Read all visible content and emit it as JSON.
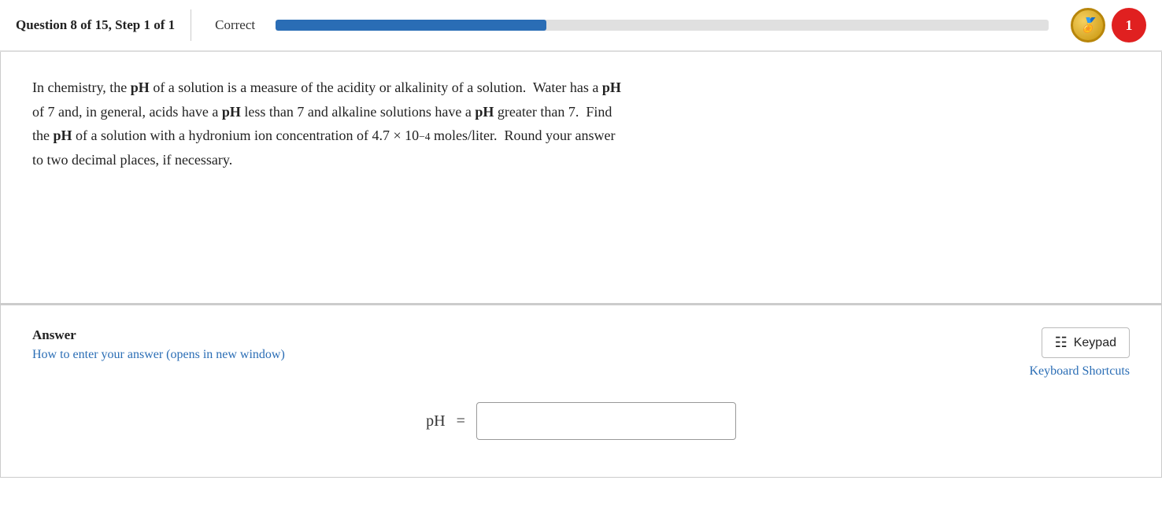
{
  "header": {
    "question_label": "Question 8 of 15, Step 1 of 1",
    "correct_label": "Correct",
    "progress_percent": 35,
    "coin_symbol": "✦",
    "heart_count": "1"
  },
  "question": {
    "paragraph1_before_ph1": "In chemistry, the ",
    "ph_bold_1": "pH",
    "paragraph1_after_ph1": " of a solution is a measure of the acidity or alkalinity of a solution.  Water has a ",
    "ph_bold_2": "pH",
    "paragraph2_before_ph2": " of 7 and, in general, acids have a ",
    "ph_bold_3": "pH",
    "paragraph2_after_ph2": " less than 7 and alkaline solutions have a ",
    "ph_bold_4": "pH",
    "paragraph2_end": " greater than 7.  Find",
    "paragraph3_before_ph3": "the ",
    "ph_bold_5": "pH",
    "paragraph3_middle": " of a solution with a hydronium ion concentration of ",
    "math_coefficient": "4.7",
    "math_times": "×",
    "math_base": "10",
    "math_exponent": "−4",
    "paragraph3_end": " moles/liter.  Round your answer",
    "paragraph4": "to two decimal places, if necessary."
  },
  "answer": {
    "title": "Answer",
    "how_to_link": "How to enter your answer (opens in new window)",
    "keypad_label": "Keypad",
    "keyboard_shortcuts_label": "Keyboard Shortcuts",
    "ph_input_label": "pH",
    "equals": "=",
    "input_placeholder": ""
  }
}
